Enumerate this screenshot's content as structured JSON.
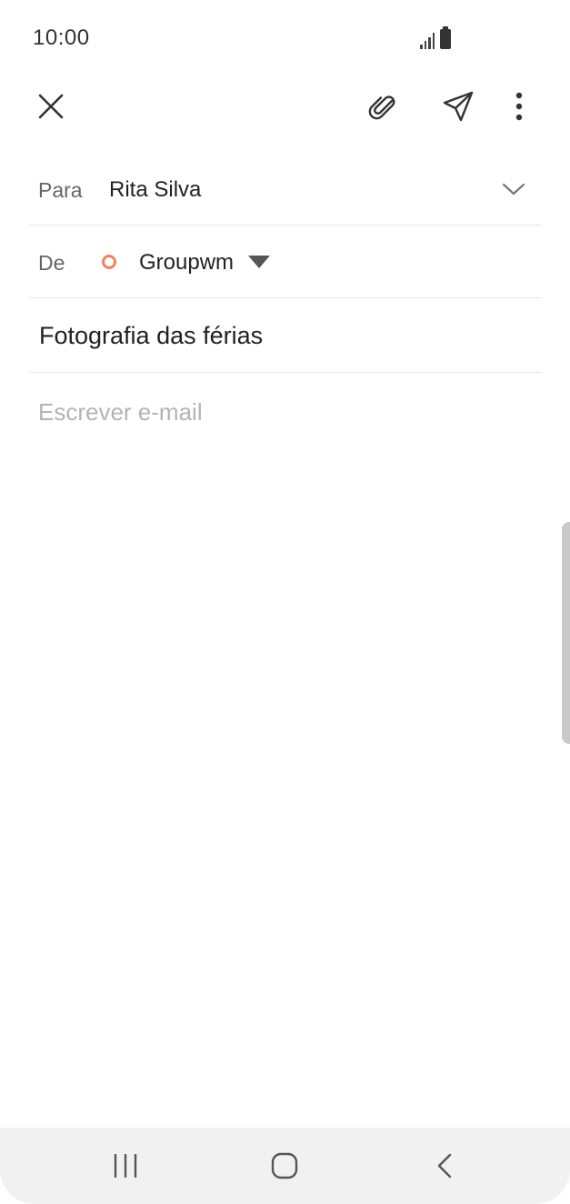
{
  "status_bar": {
    "time": "10:00",
    "icons": [
      "signal-icon",
      "battery-icon"
    ]
  },
  "toolbar": {
    "icons": [
      "close-icon",
      "paperclip-icon",
      "send-icon",
      "more-vertical-icon"
    ]
  },
  "compose": {
    "to_label": "Para",
    "to_value": "Rita Silva",
    "from_label": "De",
    "from_value": "Groupwm",
    "subject_value": "Fotografia das férias",
    "body_placeholder": "Escrever e-mail"
  },
  "nav_bar": {
    "icons": [
      "recent-apps-icon",
      "home-icon",
      "back-icon"
    ]
  },
  "colors": {
    "account_accent": "#f0855a",
    "icon": "#333333",
    "divider": "#e6e6e6",
    "placeholder": "#b4b4b4",
    "nav_background": "#f1f1f1"
  }
}
